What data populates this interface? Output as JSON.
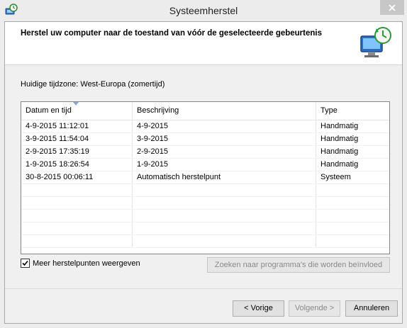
{
  "window": {
    "title": "Systeemherstel"
  },
  "header": {
    "text": "Herstel uw computer naar de toestand van vóór de geselecteerde gebeurtenis"
  },
  "timezone": "Huidige tijdzone: West-Europa (zomertijd)",
  "table": {
    "columns": [
      "Datum en tijd",
      "Beschrijving",
      "Type"
    ],
    "rows": [
      [
        "4-9-2015 11:12:01",
        "4-9-2015",
        "Handmatig"
      ],
      [
        "3-9-2015 11:54:04",
        "3-9-2015",
        "Handmatig"
      ],
      [
        "2-9-2015 17:35:19",
        "2-9-2015",
        "Handmatig"
      ],
      [
        "1-9-2015 18:26:54",
        "1-9-2015",
        "Handmatig"
      ],
      [
        "30-8-2015 00:06:11",
        "Automatisch herstelpunt",
        "Systeem"
      ],
      [
        "",
        "",
        ""
      ],
      [
        "",
        "",
        ""
      ],
      [
        "",
        "",
        ""
      ],
      [
        "",
        "",
        ""
      ],
      [
        "",
        "",
        ""
      ]
    ]
  },
  "options": {
    "more_points_label": "Meer herstelpunten weergeven",
    "more_points_checked": true
  },
  "buttons": {
    "search": "Zoeken naar programma's die worden beïnvloed",
    "back": "< Vorige",
    "next": "Volgende >",
    "cancel": "Annuleren"
  },
  "icons": {
    "app": "system-restore-icon",
    "header": "computer-restore-icon",
    "close": "close-icon",
    "sort": "sort-descending-icon"
  }
}
